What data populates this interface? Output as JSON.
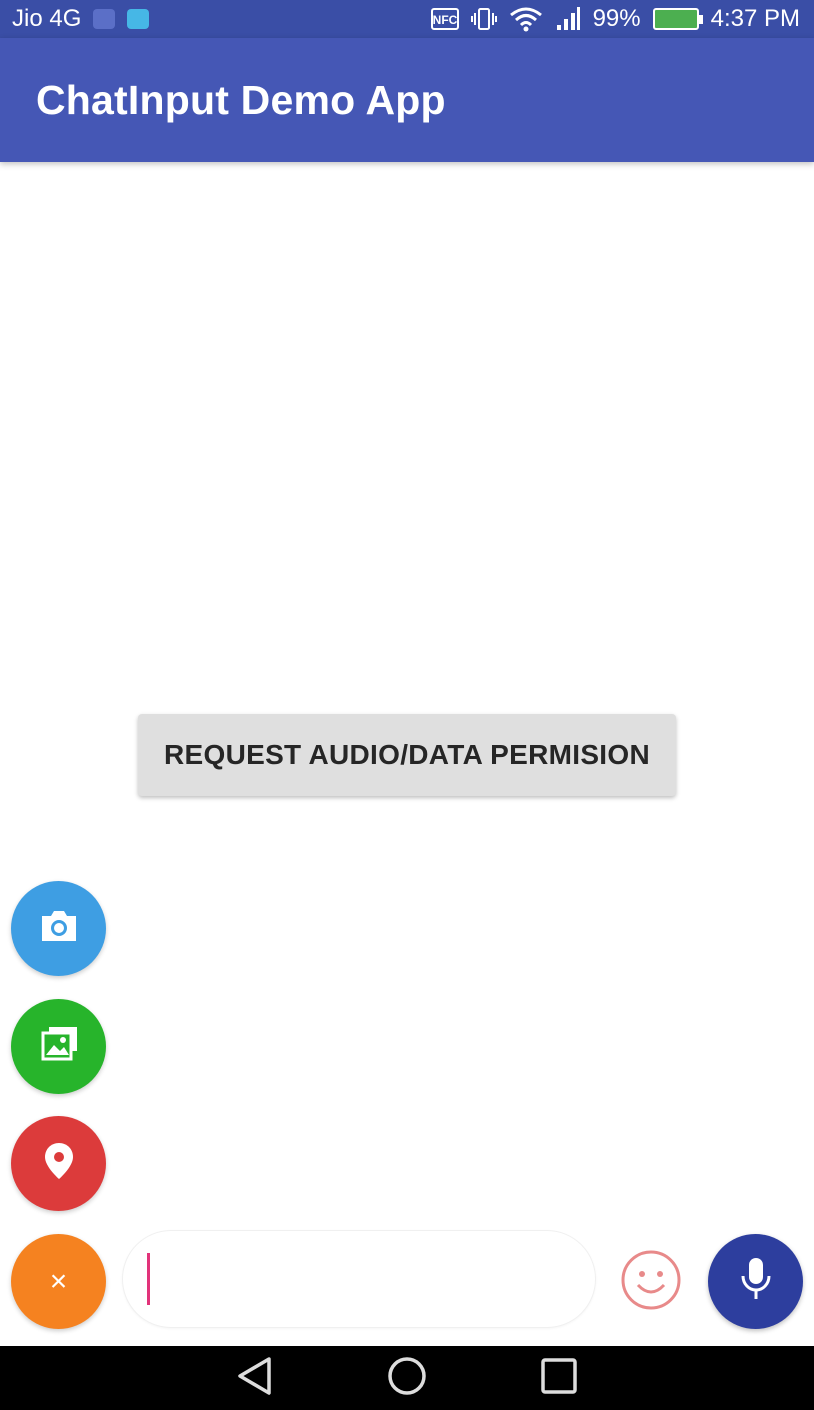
{
  "status_bar": {
    "carrier": "Jio 4G",
    "battery_percent": "99%",
    "time": "4:37 PM",
    "icons": [
      "notification-icon",
      "android-icon",
      "nfc-icon",
      "vibrate-icon",
      "wifi-icon",
      "signal-icon",
      "battery-charging-icon"
    ]
  },
  "app_bar": {
    "title": "ChatInput Demo App"
  },
  "content": {
    "permission_button_label": "REQUEST AUDIO/DATA PERMISION"
  },
  "fab_menu": {
    "items": [
      {
        "icon": "camera-icon",
        "color": "#3e9ee3"
      },
      {
        "icon": "gallery-icon",
        "color": "#27b42b"
      },
      {
        "icon": "location-pin-icon",
        "color": "#dc3b3b"
      }
    ],
    "close_label": "×",
    "close_color": "#f58220"
  },
  "input_bar": {
    "value": "",
    "cursor_color": "#e2337a",
    "emoji_icon": "smiley-icon",
    "mic_icon": "microphone-icon",
    "mic_color": "#2d3e9e"
  },
  "nav_bar": {
    "buttons": [
      "back-icon",
      "home-icon",
      "recents-icon"
    ]
  },
  "colors": {
    "primary": "#4557b5",
    "status_bar": "#3a4ea6"
  }
}
